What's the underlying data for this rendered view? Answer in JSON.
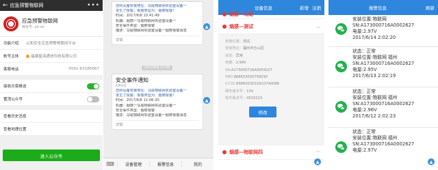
{
  "panel1": {
    "topbar": {
      "back_icon": "back-arrow",
      "title": "应急预警物联网",
      "more": "•••"
    },
    "profile": {
      "name": "应急预警物联网",
      "subtitle": "微信号: alt-iot"
    },
    "info_rows": [
      {
        "key": "功能介绍",
        "value": "以和安全应急预警物联网平台"
      },
      {
        "key": "帐号主体",
        "value": "福建星海通信科技有限公司"
      },
      {
        "key": "客服电话",
        "value": "0591-63185667"
      }
    ],
    "toggles": [
      {
        "label": "接收文章推送",
        "on": true
      },
      {
        "label": "置顶公众号",
        "on": false
      }
    ],
    "links": [
      "查看历史消息",
      "查看地理位置"
    ],
    "enter_button": "进入公众号"
  },
  "panel2": {
    "msg1": {
      "lines": [
        "您的设备安装地址：马尾物联网实验室设备一",
        "发生了报警，报警类型为：烟雾报警！",
        "时间：2017/6/6 10:41:49",
        "机器：烟感一马尾物联网实验室设备一",
        "安全事件类型：烟雾报警",
        "描述：马尾物联网实验室设备一烟雾报警消息"
      ],
      "detail": "详情"
    },
    "timestamp": "2017/6/6 11:06",
    "msg2": {
      "title": "安全事件通知",
      "date": "6月6日",
      "lines": [
        "您的设备安装地址：马尾物联网实验室设备一",
        "发生了报警，报警类型为：烟雾报警！",
        "时间：2017/6/6 11:06:30",
        "机器：烟感一马尾物联网实验室设备一",
        "安全事件类型：烟雾报警",
        "描述：马尾物联网实验室设备一烟雾报警消息"
      ],
      "detail": "详情"
    },
    "bottombar": {
      "keyboard_icon": "keyboard",
      "menus": [
        "设备管理",
        "报警信息",
        "我的"
      ]
    }
  },
  "panel3": {
    "header": {
      "title": "设备信息",
      "actions": [
        "新增",
        "注销"
      ]
    },
    "device_top": "烟感一马尾",
    "device_open": "烟感—测试",
    "details": [
      {
        "k": "安装位置：",
        "v": "测试"
      },
      {
        "k": "安装地址：",
        "v": "福州市仓山区"
      },
      {
        "k": "状态：",
        "v": "异常"
      },
      {
        "k": "电量：",
        "v": "2.99V"
      },
      {
        "k": "SN:",
        "v": "A173000716A0003027"
      },
      {
        "k": "IMEI:",
        "v": "868833030750030"
      },
      {
        "k": "ICCID:",
        "v": "89860030316C0740086"
      },
      {
        "k": "硬件版本号：",
        "v": "134"
      },
      {
        "k": "软件版本号：",
        "v": "4533223"
      }
    ],
    "edit_button": "修改",
    "device_bottom": "烟感—物联网四"
  },
  "panel4": {
    "header": {
      "title": "报警信息",
      "refresh": "刷新"
    },
    "items": [
      {
        "lines": [
          "安装位置:物联网",
          "SN:A173000716A0002627",
          "电量:2.97V",
          "2017/6/14 2:02:20"
        ]
      },
      {
        "lines": [
          "状态：正常",
          "安装位置:物联网 福州",
          "SN:A173000716A0002627",
          "电量:2.95V",
          "2017/6/13 2:02:19"
        ]
      },
      {
        "lines": [
          "状态：正常",
          "安装位置:物联网 福州",
          "SN:A173000716A0002627",
          "电量:2.96V",
          "2017/6/12 2:02:23"
        ]
      },
      {
        "lines": [
          "状态：正常",
          "安装位置:物联网 福州",
          "SN:A173000716A0002627",
          "电量:2.97V"
        ]
      }
    ]
  }
}
